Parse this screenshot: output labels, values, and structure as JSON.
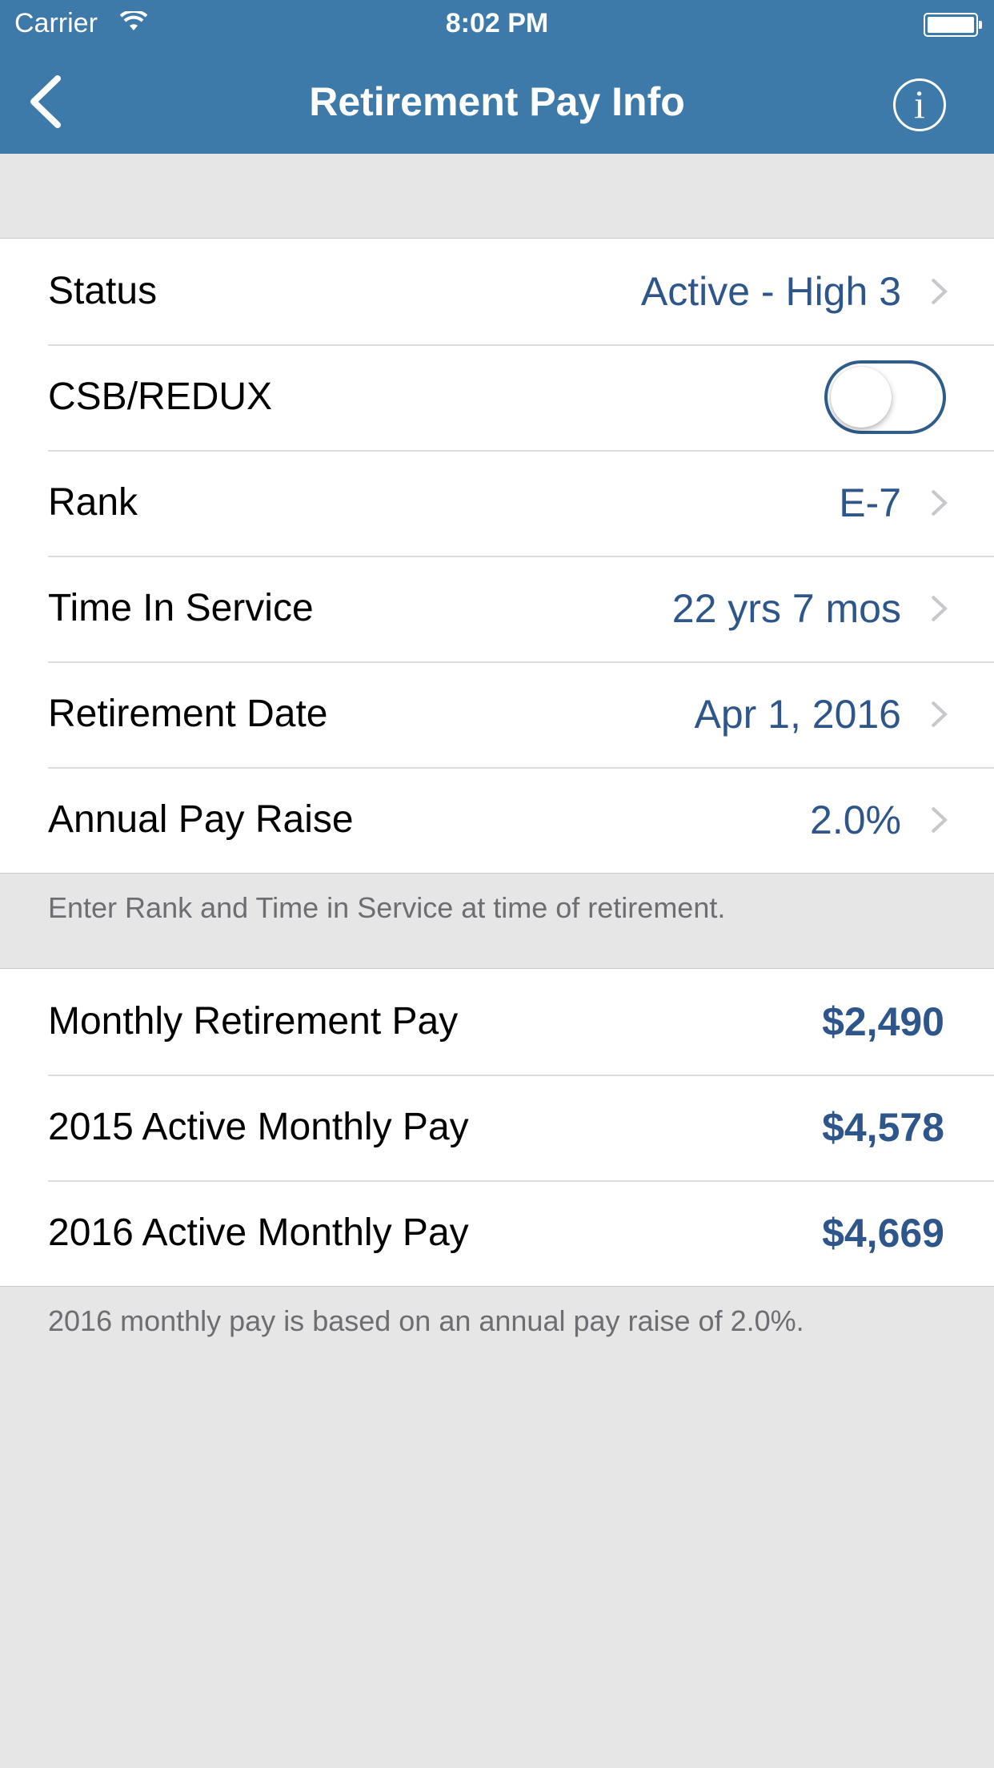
{
  "status_bar": {
    "carrier": "Carrier",
    "time": "8:02 PM"
  },
  "nav": {
    "title": "Retirement Pay Info",
    "info_glyph": "i"
  },
  "settings": {
    "status": {
      "label": "Status",
      "value": "Active - High 3"
    },
    "csb_redux": {
      "label": "CSB/REDUX",
      "enabled": false
    },
    "rank": {
      "label": "Rank",
      "value": "E-7"
    },
    "time_in_service": {
      "label": "Time In Service",
      "value": "22 yrs 7 mos"
    },
    "retirement_date": {
      "label": "Retirement Date",
      "value": "Apr 1, 2016"
    },
    "annual_pay_raise": {
      "label": "Annual Pay Raise",
      "value": "2.0%"
    }
  },
  "settings_footer": "Enter Rank and Time in Service at time of retirement.",
  "results": {
    "monthly_retirement": {
      "label": "Monthly Retirement Pay",
      "value": "$2,490"
    },
    "active_2015": {
      "label": "2015 Active Monthly Pay",
      "value": "$4,578"
    },
    "active_2016": {
      "label": "2016 Active Monthly Pay",
      "value": "$4,669"
    }
  },
  "results_footer": "2016 monthly pay is based on an annual pay raise of 2.0%.",
  "colors": {
    "nav_bg": "#3d7aa9",
    "value_text": "#2f568a",
    "page_bg": "#e6e6e6"
  },
  "icons": [
    "wifi-icon",
    "battery-icon",
    "back-chevron-icon",
    "info-icon",
    "chevron-right-icon"
  ]
}
